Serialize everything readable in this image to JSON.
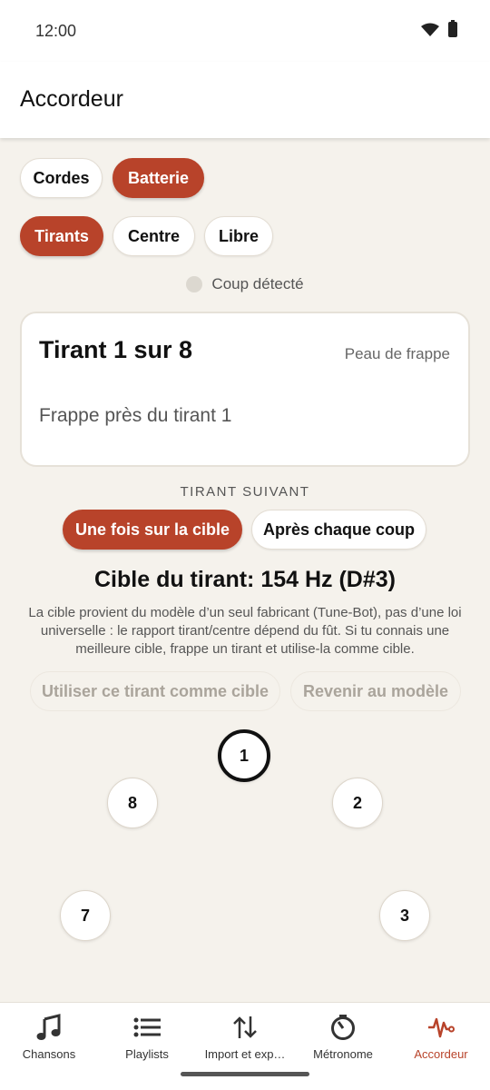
{
  "status_bar": {
    "time": "12:00",
    "icons": [
      "wifi-icon",
      "battery-icon"
    ]
  },
  "app_bar": {
    "title": "Accordeur"
  },
  "instrument_chips": [
    {
      "label": "Cordes",
      "active": false
    },
    {
      "label": "Batterie",
      "active": true
    }
  ],
  "mode_chips": [
    {
      "label": "Tirants",
      "active": true
    },
    {
      "label": "Centre",
      "active": false
    },
    {
      "label": "Libre",
      "active": false
    }
  ],
  "detection": {
    "label": "Coup détecté"
  },
  "card": {
    "title": "Tirant 1 sur 8",
    "side": "Peau de frappe",
    "hint": "Frappe près du tirant 1"
  },
  "next_lug": {
    "label": "TIRANT SUIVANT",
    "options": [
      {
        "label": "Une fois sur la cible",
        "active": true
      },
      {
        "label": "Après chaque coup",
        "active": false
      }
    ]
  },
  "target": {
    "title": "Cible du tirant: 154 Hz (D#3)",
    "note": "La cible provient du modèle d’un seul fabricant (Tune-Bot), pas d’une loi universelle : le rapport tirant/centre dépend du fût. Si tu connais une meilleure cible, frappe un tirant et utilise-la comme cible."
  },
  "actions": {
    "use_as_target": "Utiliser ce tirant comme cible",
    "revert_model": "Revenir au modèle"
  },
  "lugs": [
    {
      "label": "1",
      "current": true
    },
    {
      "label": "2",
      "current": false
    },
    {
      "label": "3",
      "current": false
    },
    {
      "label": "7",
      "current": false
    },
    {
      "label": "8",
      "current": false
    }
  ],
  "bottom_nav": [
    {
      "label": "Chansons",
      "icon": "music-note-icon",
      "active": false
    },
    {
      "label": "Playlists",
      "icon": "playlist-icon",
      "active": false
    },
    {
      "label": "Import et exp…",
      "icon": "import-export-icon",
      "active": false
    },
    {
      "label": "Métronome",
      "icon": "metronome-icon",
      "active": false
    },
    {
      "label": "Accordeur",
      "icon": "waveform-icon",
      "active": true
    }
  ],
  "colors": {
    "accent": "#b8432a",
    "background": "#f5f2ec"
  }
}
